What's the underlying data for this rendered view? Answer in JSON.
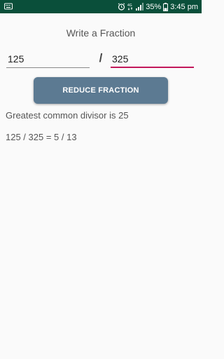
{
  "status_bar": {
    "battery_percent": "35%",
    "time": "3:45 pm",
    "background_color": "#0a4f3a",
    "icons": [
      "keyboard-icon",
      "alarm-icon",
      "network-4g-icon",
      "signal-icon",
      "battery-icon"
    ]
  },
  "app": {
    "title": "Write a Fraction",
    "separator": "/",
    "button_label": "REDUCE FRACTION",
    "accent_color": "#c2185b",
    "button_color": "#5c7a92"
  },
  "inputs": {
    "numerator": "125",
    "denominator": "325"
  },
  "results": {
    "gcd_line": "Greatest common divisor is 25",
    "equation_line": "125 / 325 = 5 / 13"
  }
}
